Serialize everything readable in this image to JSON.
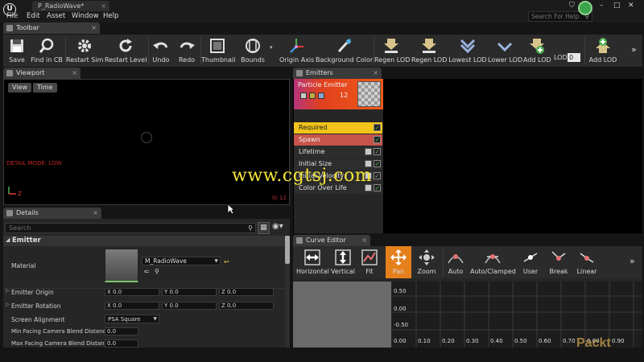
{
  "menubar": {
    "doc_tab": "P_RadioWave*",
    "items": [
      "File",
      "Edit",
      "Asset",
      "Window",
      "Help"
    ],
    "search_placeholder": "Search For Help"
  },
  "toolbar_tab": "Toolbar",
  "toolbar": {
    "buttons": [
      "Save",
      "Find in CB",
      "Restart Sim",
      "Restart Level",
      "Undo",
      "Redo",
      "Thumbnail",
      "Bounds",
      "Origin Axis",
      "Background Color",
      "Regen LOD",
      "Regen LOD",
      "Lowest LOD",
      "Lower LOD",
      "Add LOD",
      "LOD:",
      "Add LOD"
    ],
    "lod_value": "0"
  },
  "viewport": {
    "tab": "Viewport",
    "view_btn": "View",
    "time_btn": "Time",
    "mode_text": "DETAIL MODE: LOW",
    "counter": "0/ 12"
  },
  "emitters": {
    "tab": "Emitters",
    "emitter_name": "Particle Emitter",
    "emitter_count": "12",
    "modules": [
      "Required",
      "Spawn",
      "Lifetime",
      "Initial Size",
      "Initial Velocity",
      "Color Over Life"
    ]
  },
  "details": {
    "tab": "Details",
    "search_placeholder": "Search",
    "section": "Emitter",
    "material_label": "Material",
    "material_value": "M_RadioWave",
    "rows": [
      {
        "label": "Emitter Origin",
        "x": "0.0",
        "y": "0.0",
        "z": "0.0"
      },
      {
        "label": "Emitter Rotation",
        "x": "0.0",
        "y": "0.0",
        "z": "0.0"
      }
    ],
    "screen_alignment_label": "Screen Alignment",
    "screen_alignment_value": "PSA Square",
    "min_label": "Min Facing Camera Blend Distance",
    "min_value": "0.0",
    "max_label": "Max Facing Camera Blend Distance",
    "max_value": "0.0"
  },
  "curve_editor": {
    "tab": "Curve Editor",
    "buttons": [
      "Horizontal",
      "Vertical",
      "Fit",
      "Pan",
      "Zoom",
      "Auto",
      "Auto/Clamped",
      "User",
      "Break",
      "Linear"
    ],
    "y_ticks": [
      "0.50",
      "0.00",
      "-0.50",
      "0.00"
    ],
    "x_ticks": [
      "0.10",
      "0.20",
      "0.30",
      "0.40",
      "0.50",
      "0.60",
      "0.70",
      "0.80",
      "0.90"
    ]
  },
  "watermark": "www.cgtsj.com",
  "brand": "Packt"
}
